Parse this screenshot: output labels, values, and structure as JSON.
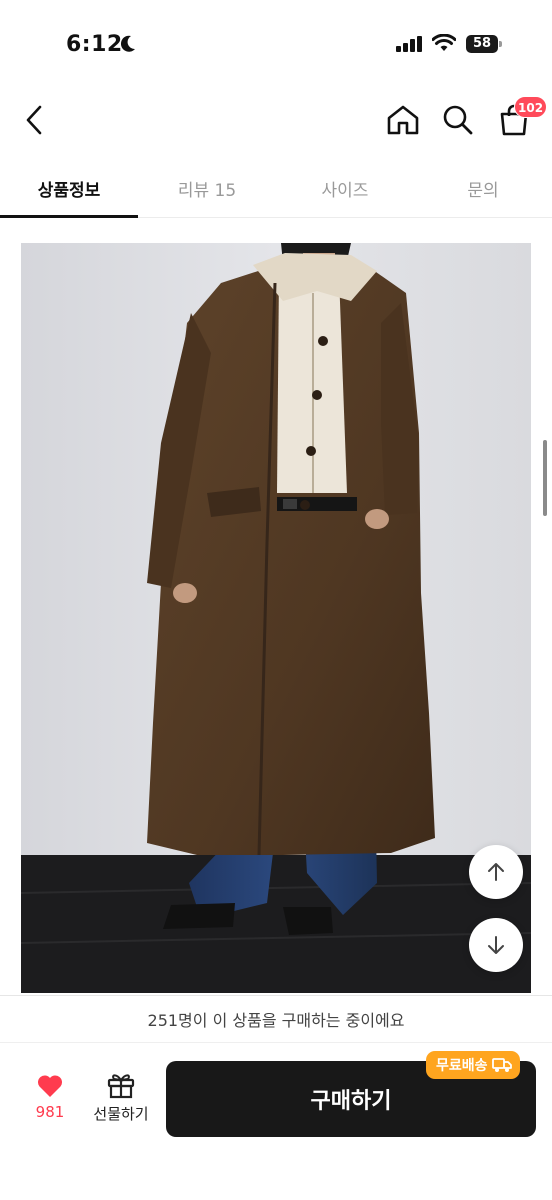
{
  "status_bar": {
    "time": "6:12",
    "battery": "58"
  },
  "nav": {
    "cart_count": "102"
  },
  "tabs": [
    {
      "label": "상품정보",
      "active": true
    },
    {
      "label": "리뷰 15",
      "active": false
    },
    {
      "label": "사이즈",
      "active": false
    },
    {
      "label": "문의",
      "active": false
    }
  ],
  "notice": {
    "text": "251명이 이 상품을 구매하는 중이에요"
  },
  "bottom": {
    "like_count": "981",
    "gift_label": "선물하기",
    "buy_label": "구매하기",
    "free_shipping_badge": "무료배송"
  },
  "colors": {
    "accent": "#ff4a5a",
    "like": "#ff3b4e",
    "buy_button": "#181818",
    "shipping_badge": "#ffa51f"
  },
  "icons": [
    "moon-icon",
    "signal-icon",
    "wifi-icon",
    "back-icon",
    "home-icon",
    "search-icon",
    "cart-icon",
    "arrow-up-icon",
    "arrow-down-icon",
    "heart-icon",
    "gift-icon",
    "truck-icon"
  ]
}
